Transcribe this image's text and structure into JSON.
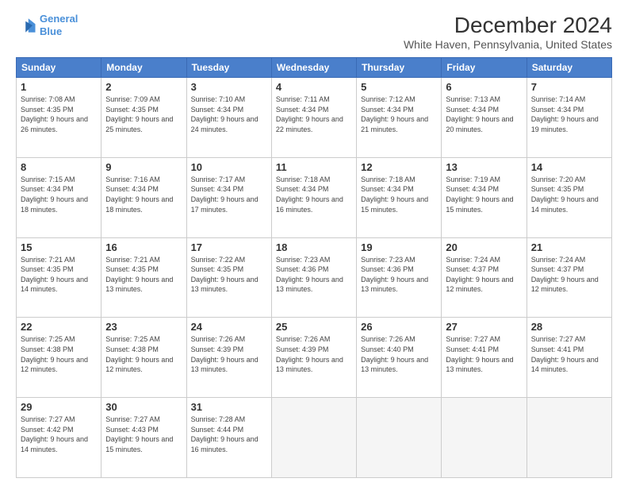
{
  "logo": {
    "line1": "General",
    "line2": "Blue"
  },
  "title": "December 2024",
  "subtitle": "White Haven, Pennsylvania, United States",
  "days_of_week": [
    "Sunday",
    "Monday",
    "Tuesday",
    "Wednesday",
    "Thursday",
    "Friday",
    "Saturday"
  ],
  "weeks": [
    [
      {
        "day": "1",
        "sunrise": "7:08 AM",
        "sunset": "4:35 PM",
        "daylight": "9 hours and 26 minutes."
      },
      {
        "day": "2",
        "sunrise": "7:09 AM",
        "sunset": "4:35 PM",
        "daylight": "9 hours and 25 minutes."
      },
      {
        "day": "3",
        "sunrise": "7:10 AM",
        "sunset": "4:34 PM",
        "daylight": "9 hours and 24 minutes."
      },
      {
        "day": "4",
        "sunrise": "7:11 AM",
        "sunset": "4:34 PM",
        "daylight": "9 hours and 22 minutes."
      },
      {
        "day": "5",
        "sunrise": "7:12 AM",
        "sunset": "4:34 PM",
        "daylight": "9 hours and 21 minutes."
      },
      {
        "day": "6",
        "sunrise": "7:13 AM",
        "sunset": "4:34 PM",
        "daylight": "9 hours and 20 minutes."
      },
      {
        "day": "7",
        "sunrise": "7:14 AM",
        "sunset": "4:34 PM",
        "daylight": "9 hours and 19 minutes."
      }
    ],
    [
      {
        "day": "8",
        "sunrise": "7:15 AM",
        "sunset": "4:34 PM",
        "daylight": "9 hours and 18 minutes."
      },
      {
        "day": "9",
        "sunrise": "7:16 AM",
        "sunset": "4:34 PM",
        "daylight": "9 hours and 18 minutes."
      },
      {
        "day": "10",
        "sunrise": "7:17 AM",
        "sunset": "4:34 PM",
        "daylight": "9 hours and 17 minutes."
      },
      {
        "day": "11",
        "sunrise": "7:18 AM",
        "sunset": "4:34 PM",
        "daylight": "9 hours and 16 minutes."
      },
      {
        "day": "12",
        "sunrise": "7:18 AM",
        "sunset": "4:34 PM",
        "daylight": "9 hours and 15 minutes."
      },
      {
        "day": "13",
        "sunrise": "7:19 AM",
        "sunset": "4:34 PM",
        "daylight": "9 hours and 15 minutes."
      },
      {
        "day": "14",
        "sunrise": "7:20 AM",
        "sunset": "4:35 PM",
        "daylight": "9 hours and 14 minutes."
      }
    ],
    [
      {
        "day": "15",
        "sunrise": "7:21 AM",
        "sunset": "4:35 PM",
        "daylight": "9 hours and 14 minutes."
      },
      {
        "day": "16",
        "sunrise": "7:21 AM",
        "sunset": "4:35 PM",
        "daylight": "9 hours and 13 minutes."
      },
      {
        "day": "17",
        "sunrise": "7:22 AM",
        "sunset": "4:35 PM",
        "daylight": "9 hours and 13 minutes."
      },
      {
        "day": "18",
        "sunrise": "7:23 AM",
        "sunset": "4:36 PM",
        "daylight": "9 hours and 13 minutes."
      },
      {
        "day": "19",
        "sunrise": "7:23 AM",
        "sunset": "4:36 PM",
        "daylight": "9 hours and 13 minutes."
      },
      {
        "day": "20",
        "sunrise": "7:24 AM",
        "sunset": "4:37 PM",
        "daylight": "9 hours and 12 minutes."
      },
      {
        "day": "21",
        "sunrise": "7:24 AM",
        "sunset": "4:37 PM",
        "daylight": "9 hours and 12 minutes."
      }
    ],
    [
      {
        "day": "22",
        "sunrise": "7:25 AM",
        "sunset": "4:38 PM",
        "daylight": "9 hours and 12 minutes."
      },
      {
        "day": "23",
        "sunrise": "7:25 AM",
        "sunset": "4:38 PM",
        "daylight": "9 hours and 12 minutes."
      },
      {
        "day": "24",
        "sunrise": "7:26 AM",
        "sunset": "4:39 PM",
        "daylight": "9 hours and 13 minutes."
      },
      {
        "day": "25",
        "sunrise": "7:26 AM",
        "sunset": "4:39 PM",
        "daylight": "9 hours and 13 minutes."
      },
      {
        "day": "26",
        "sunrise": "7:26 AM",
        "sunset": "4:40 PM",
        "daylight": "9 hours and 13 minutes."
      },
      {
        "day": "27",
        "sunrise": "7:27 AM",
        "sunset": "4:41 PM",
        "daylight": "9 hours and 13 minutes."
      },
      {
        "day": "28",
        "sunrise": "7:27 AM",
        "sunset": "4:41 PM",
        "daylight": "9 hours and 14 minutes."
      }
    ],
    [
      {
        "day": "29",
        "sunrise": "7:27 AM",
        "sunset": "4:42 PM",
        "daylight": "9 hours and 14 minutes."
      },
      {
        "day": "30",
        "sunrise": "7:27 AM",
        "sunset": "4:43 PM",
        "daylight": "9 hours and 15 minutes."
      },
      {
        "day": "31",
        "sunrise": "7:28 AM",
        "sunset": "4:44 PM",
        "daylight": "9 hours and 16 minutes."
      },
      null,
      null,
      null,
      null
    ]
  ]
}
